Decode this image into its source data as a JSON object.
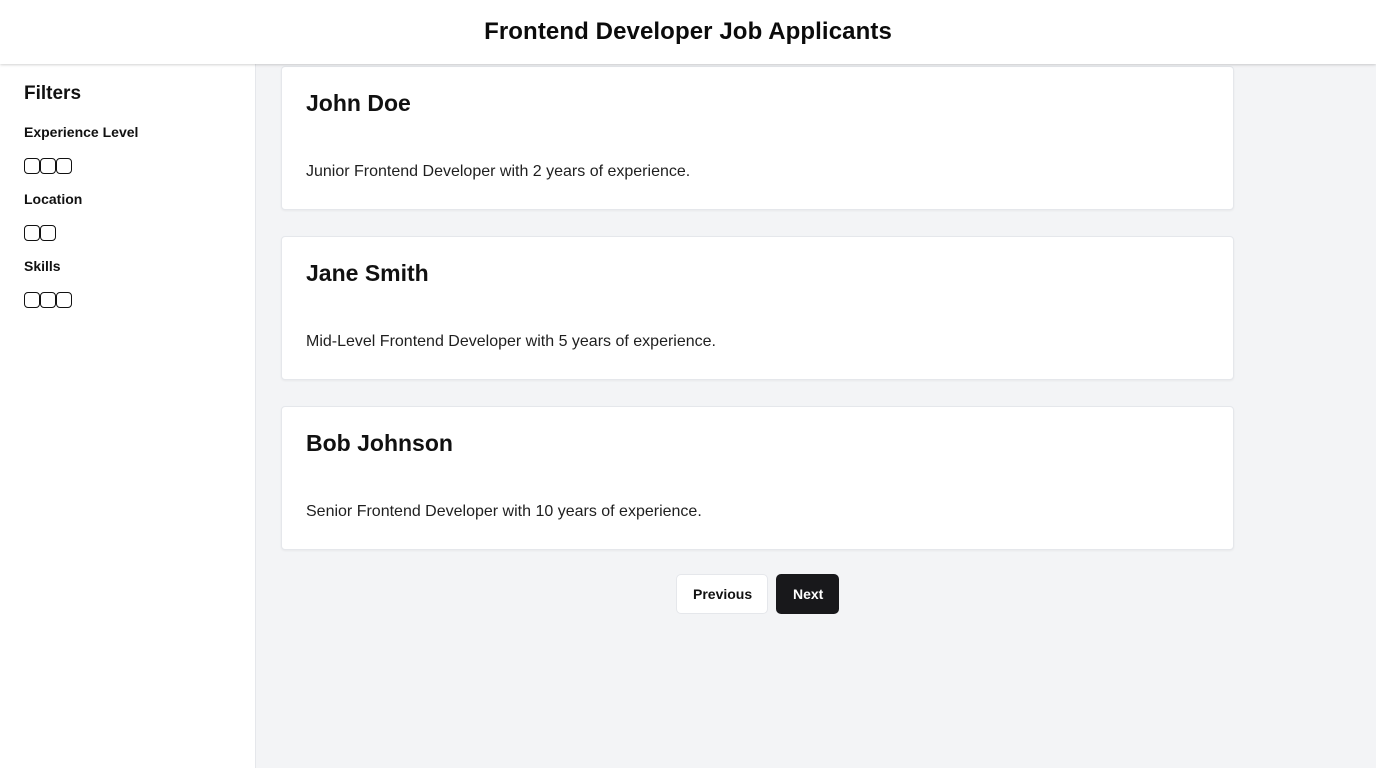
{
  "header": {
    "title": "Frontend Developer Job Applicants"
  },
  "sidebar": {
    "title": "Filters",
    "groups": [
      {
        "label": "Experience Level",
        "chip_count": 3
      },
      {
        "label": "Location",
        "chip_count": 2
      },
      {
        "label": "Skills",
        "chip_count": 3
      }
    ]
  },
  "applicants": [
    {
      "name": "John Doe",
      "summary": "Junior Frontend Developer with 2 years of experience."
    },
    {
      "name": "Jane Smith",
      "summary": "Mid-Level Frontend Developer with 5 years of experience."
    },
    {
      "name": "Bob Johnson",
      "summary": "Senior Frontend Developer with 10 years of experience."
    }
  ],
  "pagination": {
    "previous_label": "Previous",
    "next_label": "Next"
  },
  "colors": {
    "page_bg": "#f3f4f6",
    "surface": "#ffffff",
    "primary_button": "#18181b",
    "border": "#e5e7eb"
  }
}
